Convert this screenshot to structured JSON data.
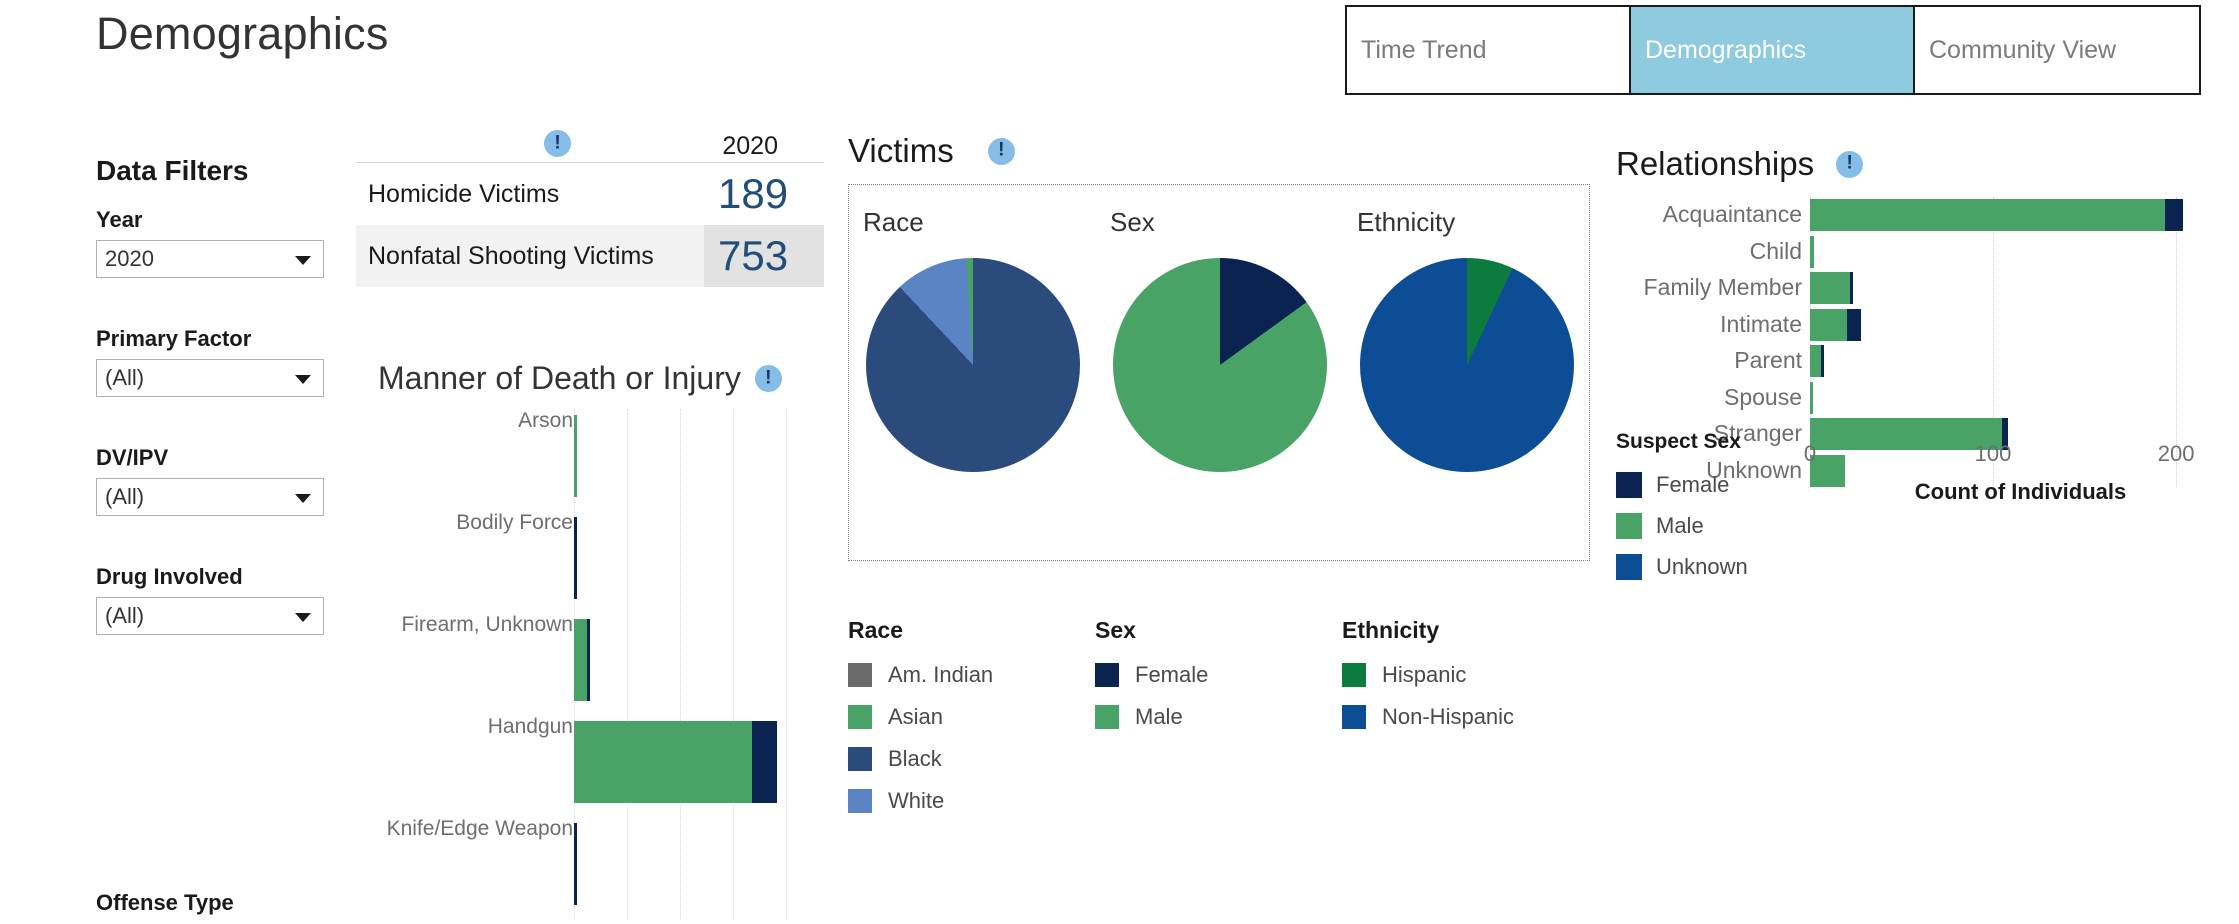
{
  "header": {
    "page_title": "Demographics",
    "tabs": [
      {
        "label": "Time Trend",
        "selected": false
      },
      {
        "label": "Demographics",
        "selected": true
      },
      {
        "label": "Community View",
        "selected": false
      }
    ],
    "selected_tab_bg": "#8ecbdf"
  },
  "sidebar": {
    "title": "Data Filters",
    "filters": [
      {
        "label": "Year",
        "value": "2020"
      },
      {
        "label": "Primary Factor",
        "value": "(All)"
      },
      {
        "label": "DV/IPV",
        "value": "(All)"
      },
      {
        "label": "Drug Involved",
        "value": "(All)"
      }
    ],
    "offense_type_label": "Offense Type"
  },
  "kpi": {
    "info_icon": "info-icon",
    "year_header": "2020",
    "rows": [
      {
        "name": "Homicide Victims",
        "value": "189",
        "highlighted": false
      },
      {
        "name": "Nonfatal Shooting Victims",
        "value": "753",
        "highlighted": true
      }
    ],
    "value_color": "#1f4e79"
  },
  "manner": {
    "title": "Manner of Death or Injury",
    "info_icon": "info-icon"
  },
  "victims": {
    "title": "Victims",
    "info_icon": "info-icon",
    "pie_titles": [
      "Race",
      "Sex",
      "Ethnicity"
    ],
    "legends": [
      {
        "title": "Race",
        "items": [
          {
            "label": "Am. Indian",
            "color": "#6b6b6b"
          },
          {
            "label": "Asian",
            "color": "#4aa366"
          },
          {
            "label": "Black",
            "color": "#2a4b7c"
          },
          {
            "label": "White",
            "color": "#5b84c4"
          }
        ]
      },
      {
        "title": "Sex",
        "items": [
          {
            "label": "Female",
            "color": "#0b2351"
          },
          {
            "label": "Male",
            "color": "#4aa366"
          }
        ]
      },
      {
        "title": "Ethnicity",
        "items": [
          {
            "label": "Hispanic",
            "color": "#0c7c3e"
          },
          {
            "label": "Non-Hispanic",
            "color": "#0c4d96"
          }
        ]
      }
    ]
  },
  "relationships": {
    "title": "Relationships",
    "info_icon": "info-icon",
    "legend": {
      "title": "Suspect Sex",
      "items": [
        {
          "label": "Female",
          "color": "#0b2351"
        },
        {
          "label": "Male",
          "color": "#4aa366"
        },
        {
          "label": "Unknown",
          "color": "#0c4d96"
        }
      ]
    }
  },
  "chart_data": [
    {
      "type": "bar",
      "id": "manner-of-death",
      "orientation": "horizontal",
      "stacked": true,
      "title": "Manner of Death or Injury",
      "xlabel": "",
      "ylabel": "",
      "categories": [
        "Arson",
        "Bodily Force",
        "Firearm, Unknown",
        "Handgun",
        "Knife/Edge Weapon"
      ],
      "series": [
        {
          "name": "Male",
          "color": "#4aa366",
          "values": [
            1,
            0,
            12,
            168,
            0
          ]
        },
        {
          "name": "Female",
          "color": "#0b2351",
          "values": [
            0,
            2,
            2,
            23,
            1
          ]
        }
      ],
      "xlim": [
        0,
        230
      ],
      "grid": true,
      "gridlines": [
        0,
        50,
        100,
        150,
        200
      ],
      "legend": "Suspect Sex (shared)"
    },
    {
      "type": "pie",
      "id": "victims-race",
      "title": "Race",
      "labels": [
        "Black",
        "White",
        "Asian",
        "Am. Indian"
      ],
      "values": [
        88,
        11,
        1,
        0
      ],
      "colors": [
        "#2a4b7c",
        "#5b84c4",
        "#4aa366",
        "#6b6b6b"
      ],
      "legend": "Race",
      "legend_position": "bottom"
    },
    {
      "type": "pie",
      "id": "victims-sex",
      "title": "Sex",
      "labels": [
        "Female",
        "Male"
      ],
      "values": [
        15,
        85
      ],
      "colors": [
        "#0b2351",
        "#4aa366"
      ],
      "legend": "Sex",
      "legend_position": "bottom"
    },
    {
      "type": "pie",
      "id": "victims-ethnicity",
      "title": "Ethnicity",
      "labels": [
        "Hispanic",
        "Non-Hispanic"
      ],
      "values": [
        7,
        93
      ],
      "colors": [
        "#0c7c3e",
        "#0c4d96"
      ],
      "legend": "Ethnicity",
      "legend_position": "bottom"
    },
    {
      "type": "bar",
      "id": "relationships",
      "orientation": "horizontal",
      "stacked": true,
      "title": "Relationships",
      "xlabel": "Count of Individuals",
      "ylabel": "",
      "categories": [
        "Acquaintance",
        "Child",
        "Family Member",
        "Intimate",
        "Parent",
        "Spouse",
        "Stranger",
        "Unknown"
      ],
      "series": [
        {
          "name": "Male",
          "color": "#4aa366",
          "values": [
            194,
            2,
            22,
            20,
            6,
            1,
            105,
            19
          ]
        },
        {
          "name": "Female",
          "color": "#0b2351",
          "values": [
            10,
            0,
            1,
            8,
            1,
            0,
            3,
            0
          ]
        },
        {
          "name": "Unknown",
          "color": "#0c4d96",
          "values": [
            0,
            0,
            0,
            0,
            0,
            0,
            0,
            0
          ]
        }
      ],
      "xlim": [
        0,
        230
      ],
      "xticks": [
        0,
        100,
        200
      ],
      "grid": true,
      "legend": "Suspect Sex",
      "legend_position": "bottom-left"
    }
  ]
}
